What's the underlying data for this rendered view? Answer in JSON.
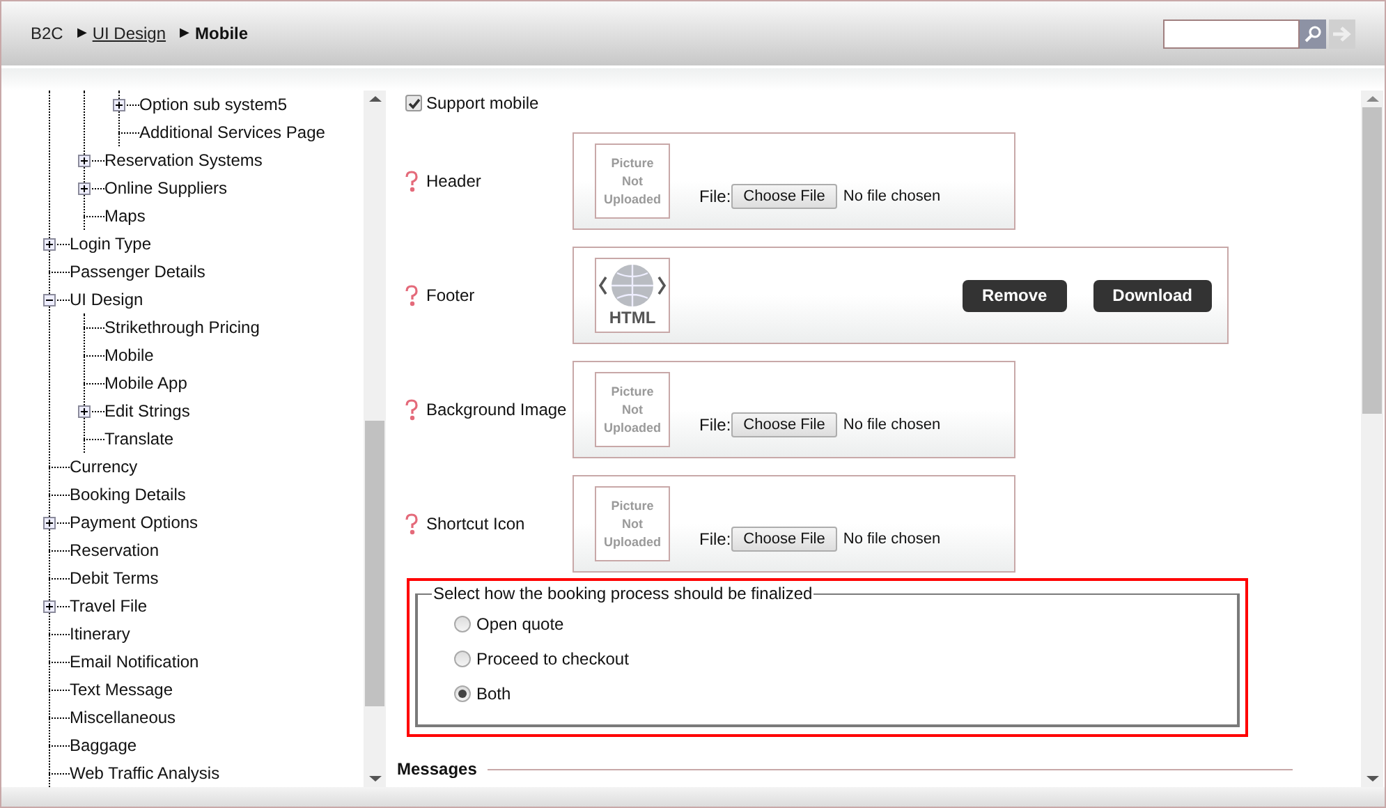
{
  "breadcrumb": [
    {
      "label": "B2C",
      "kind": "plain"
    },
    {
      "separator": "▶",
      "label": "UI Design",
      "kind": "link"
    },
    {
      "separator": "▶",
      "label": "Mobile",
      "kind": "current"
    }
  ],
  "tree": [
    {
      "kind": "hidden",
      "children": [
        {
          "kind": "hidden",
          "children": [
            {
              "label": "Option sub system5",
              "kind": "collapsed"
            },
            {
              "label": "Additional Services Page",
              "kind": "leaf"
            }
          ]
        },
        {
          "label": "Reservation Systems",
          "kind": "collapsed"
        },
        {
          "label": "Online Suppliers",
          "kind": "collapsed"
        },
        {
          "label": "Maps",
          "kind": "leaf"
        }
      ]
    },
    {
      "label": "Login Type",
      "kind": "collapsed"
    },
    {
      "label": "Passenger Details",
      "kind": "leaf"
    },
    {
      "label": "UI Design",
      "kind": "expanded",
      "children": [
        {
          "label": "Strikethrough Pricing",
          "kind": "leaf"
        },
        {
          "label": "Mobile",
          "kind": "leaf"
        },
        {
          "label": "Mobile App",
          "kind": "leaf"
        },
        {
          "label": "Edit Strings",
          "kind": "collapsed"
        },
        {
          "label": "Translate",
          "kind": "leaf"
        }
      ]
    },
    {
      "label": "Currency",
      "kind": "leaf"
    },
    {
      "label": "Booking Details",
      "kind": "leaf"
    },
    {
      "label": "Payment Options",
      "kind": "collapsed"
    },
    {
      "label": "Reservation",
      "kind": "leaf"
    },
    {
      "label": "Debit Terms",
      "kind": "leaf"
    },
    {
      "label": "Travel File",
      "kind": "collapsed"
    },
    {
      "label": "Itinerary",
      "kind": "leaf"
    },
    {
      "label": "Email Notification",
      "kind": "leaf"
    },
    {
      "label": "Text Message",
      "kind": "leaf"
    },
    {
      "label": "Miscellaneous",
      "kind": "leaf"
    },
    {
      "label": "Baggage",
      "kind": "leaf"
    },
    {
      "label": "Web Traffic Analysis",
      "kind": "leaf"
    }
  ],
  "support_mobile": {
    "label": "Support mobile",
    "checked": true
  },
  "fields": [
    {
      "label": "Header",
      "kind": "upload",
      "preview": "Picture Not Uploaded",
      "file_label": "File:",
      "button": "Choose File",
      "status": "No file chosen"
    },
    {
      "label": "Footer",
      "kind": "html",
      "preview": "HTML",
      "buttons": [
        "Remove",
        "Download"
      ]
    },
    {
      "label": "Background Image",
      "kind": "upload",
      "preview": "Picture Not Uploaded",
      "file_label": "File:",
      "button": "Choose File",
      "status": "No file chosen"
    },
    {
      "label": "Shortcut Icon",
      "kind": "upload",
      "preview": "Picture Not Uploaded",
      "file_label": "File:",
      "button": "Choose File",
      "status": "No file chosen"
    }
  ],
  "finalize": {
    "legend": "Select how the booking process should be finalized",
    "options": [
      {
        "label": "Open quote",
        "selected": false
      },
      {
        "label": "Proceed to checkout",
        "selected": false
      },
      {
        "label": "Both",
        "selected": true
      }
    ]
  },
  "messages_heading": "Messages"
}
